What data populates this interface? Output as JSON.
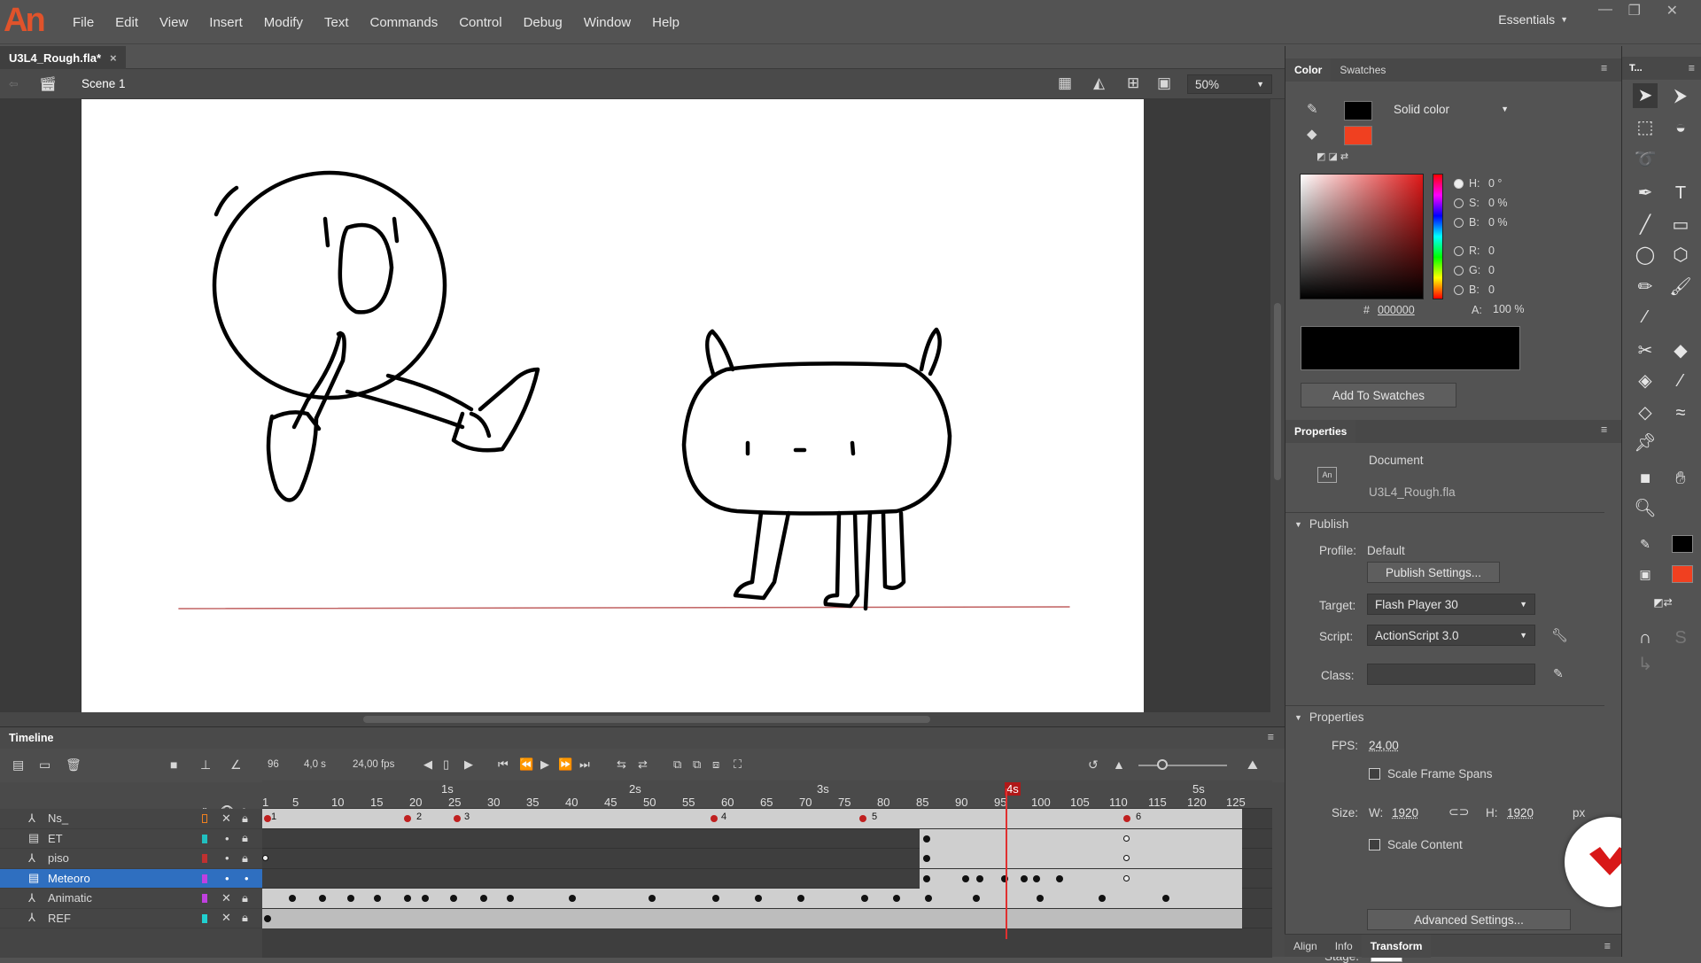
{
  "app": {
    "logo": "An"
  },
  "menu": [
    "File",
    "Edit",
    "View",
    "Insert",
    "Modify",
    "Text",
    "Commands",
    "Control",
    "Debug",
    "Window",
    "Help"
  ],
  "workspace": "Essentials",
  "doc_tab": {
    "name": "U3L4_Rough.fla*",
    "close": "×"
  },
  "scene": {
    "label": "Scene 1",
    "zoom": "50%"
  },
  "timeline": {
    "title": "Timeline",
    "frame": "96",
    "time": "4,0 s",
    "fps": "24,00 fps",
    "seconds": [
      "1s",
      "2s",
      "3s",
      "4s",
      "5s"
    ],
    "ticks": [
      "1",
      "5",
      "10",
      "15",
      "20",
      "25",
      "30",
      "35",
      "40",
      "45",
      "50",
      "55",
      "60",
      "65",
      "70",
      "75",
      "80",
      "85",
      "90",
      "95",
      "100",
      "105",
      "110",
      "115",
      "120",
      "125"
    ],
    "layers": [
      {
        "name": "Ns_",
        "color": "#f08020"
      },
      {
        "name": "ET",
        "color": "#20c0c0"
      },
      {
        "name": "piso",
        "color": "#c03030"
      },
      {
        "name": "Meteoro",
        "color": "#c040e0"
      },
      {
        "name": "Animatic",
        "color": "#c040e0"
      },
      {
        "name": "REF",
        "color": "#20d0d0"
      }
    ],
    "frame_labels": [
      "1",
      "2",
      "3",
      "4",
      "5",
      "6"
    ]
  },
  "color_panel": {
    "tabs": [
      "Color",
      "Swatches"
    ],
    "fill_type": "Solid color",
    "stroke_color": "#000000",
    "fill_color": "#f04020",
    "H": "0 °",
    "S": "0 %",
    "B": "0 %",
    "R": "0",
    "G": "0",
    "B2": "0",
    "hex_label": "#",
    "hex": "000000",
    "A": "100 %",
    "add_swatches": "Add To Swatches"
  },
  "properties": {
    "title": "Properties",
    "doc_type": "Document",
    "doc_name": "U3L4_Rough.fla",
    "publish_header": "Publish",
    "profile_label": "Profile:",
    "profile": "Default",
    "publish_settings": "Publish Settings...",
    "target_label": "Target:",
    "target": "Flash Player 30",
    "script_label": "Script:",
    "script": "ActionScript 3.0",
    "class_label": "Class:",
    "props_header": "Properties",
    "fps_label": "FPS:",
    "fps": "24,00",
    "scale_spans": "Scale Frame Spans",
    "size_label": "Size:",
    "w_label": "W:",
    "w": "1920",
    "h_label": "H:",
    "h": "1920",
    "unit": "px",
    "scale_content": "Scale Content",
    "advanced": "Advanced Settings...",
    "stage_label": "Stage:"
  },
  "bottom_tabs": [
    "Align",
    "Info",
    "Transform"
  ],
  "tools_title": "T..."
}
